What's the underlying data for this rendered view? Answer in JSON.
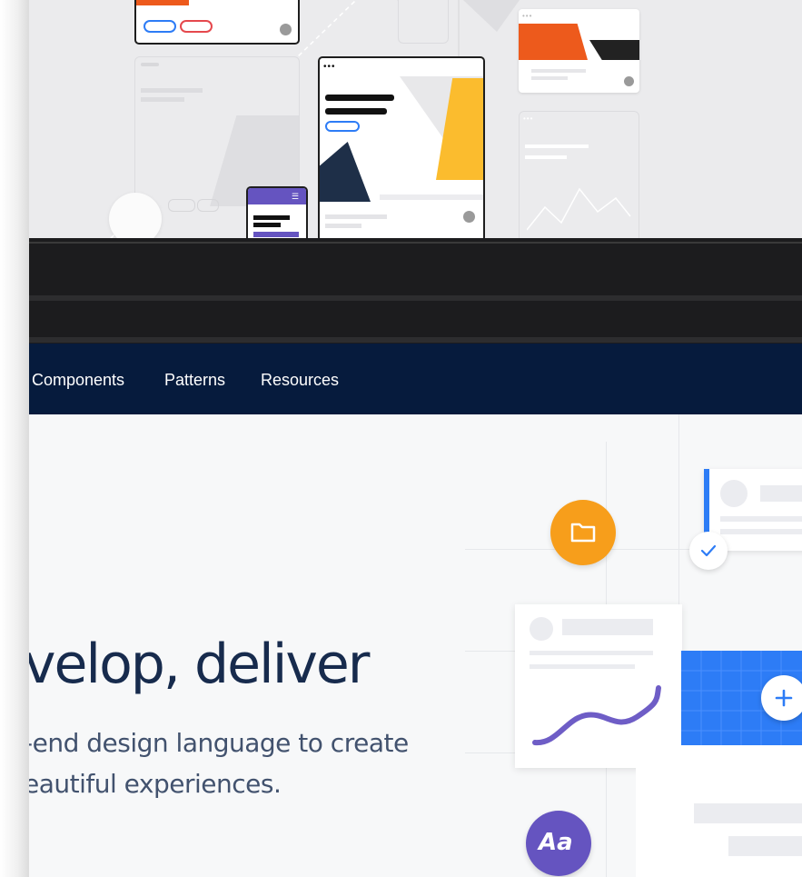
{
  "nav": {
    "items": [
      {
        "label": "Components"
      },
      {
        "label": "Patterns"
      },
      {
        "label": "Resources"
      }
    ]
  },
  "hero": {
    "title": "velop, deliver",
    "subtitle_line1": "-end design language to create",
    "subtitle_line2": "eautiful experiences.",
    "badge_text": "Aa"
  },
  "colors": {
    "nav_bg": "#061b3d",
    "accent_blue": "#2d7cf6",
    "accent_orange": "#f79e1b",
    "accent_purple": "#6554c0",
    "illus_orange": "#ed5a1c",
    "illus_yellow": "#fbbc2e",
    "heading": "#172b4d"
  },
  "icons": [
    "folder-icon",
    "check-icon",
    "plus-icon",
    "menu-icon",
    "status-check-icon"
  ]
}
